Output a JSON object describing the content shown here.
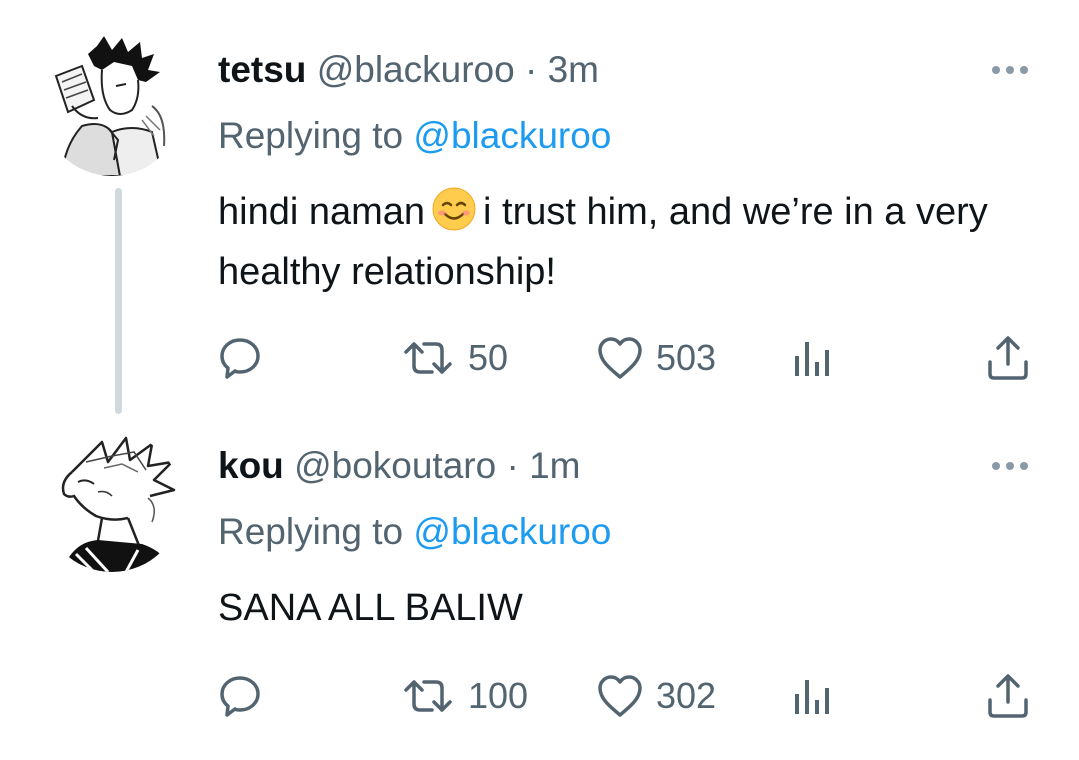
{
  "tweets": [
    {
      "name": "tetsu",
      "handle": "@blackuroo",
      "dot": "·",
      "time": "3m",
      "replying_label": "Replying to",
      "replying_to": "@blackuroo",
      "text_before_emoji": "hindi naman",
      "emoji": "smiling-face-emoji",
      "text_after_emoji": "i trust him, and we’re in a very healthy relationship!",
      "avatar": "manga-avatar-dark-hair",
      "retweets": "50",
      "likes": "503"
    },
    {
      "name": "kou",
      "handle": "@bokoutaro",
      "dot": "·",
      "time": "1m",
      "replying_label": "Replying to",
      "replying_to": "@blackuroo",
      "text": "SANA ALL BALIW",
      "avatar": "manga-avatar-spiky-hair",
      "retweets": "100",
      "likes": "302"
    }
  ],
  "colors": {
    "text": "#0f1419",
    "secondary": "#536471",
    "link": "#1d9bf0",
    "thread_line": "#cfd9de"
  },
  "icons": [
    "reply-icon",
    "retweet-icon",
    "like-icon",
    "analytics-icon",
    "share-icon",
    "more-options-icon"
  ]
}
